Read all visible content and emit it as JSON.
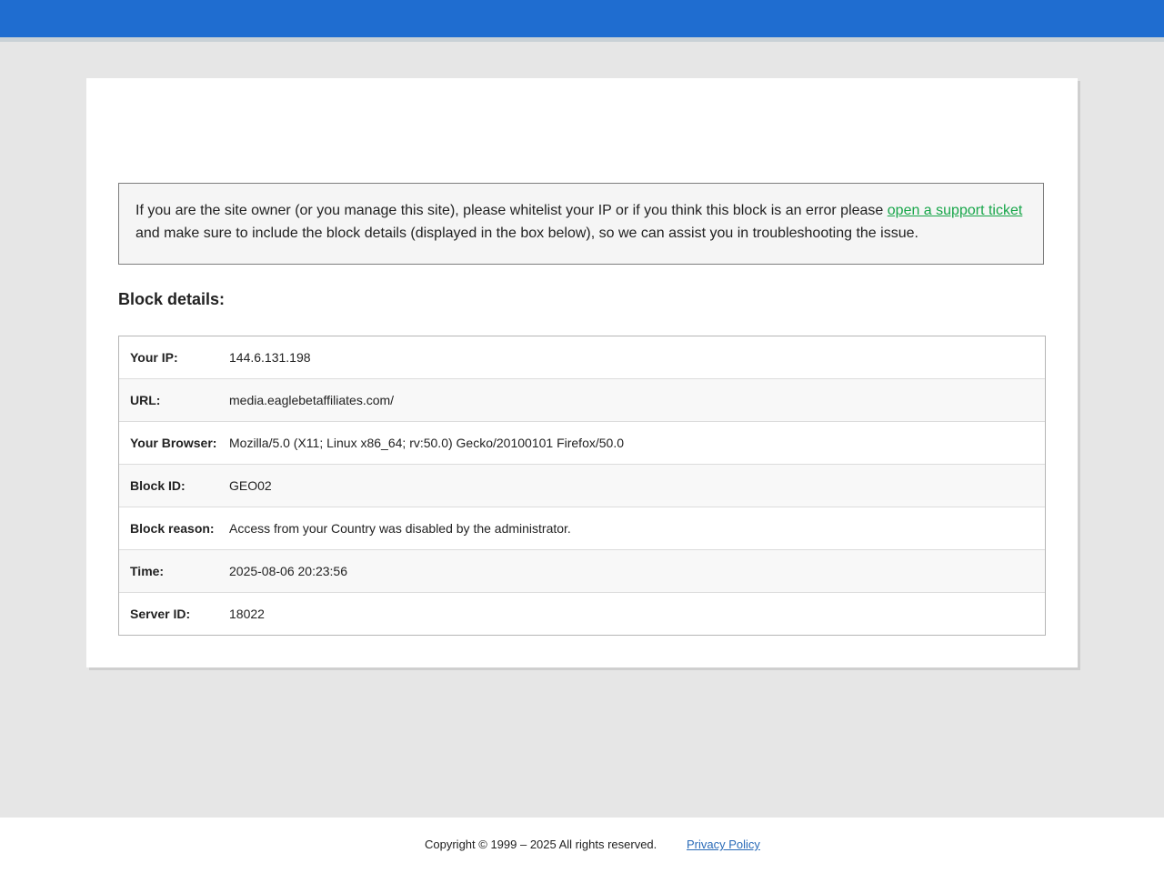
{
  "notice": {
    "text_before": "If you are the site owner (or you manage this site), please whitelist your IP or if you think this block is an error please ",
    "link_label": "open a support ticket",
    "text_after": " and make sure to include the block details (displayed in the box below), so we can assist you in troubleshooting the issue."
  },
  "block_details_title": "Block details:",
  "details": [
    {
      "label": "Your IP:",
      "value": "144.6.131.198"
    },
    {
      "label": "URL:",
      "value": "media.eaglebetaffiliates.com/"
    },
    {
      "label": "Your Browser:",
      "value": "Mozilla/5.0 (X11; Linux x86_64; rv:50.0) Gecko/20100101 Firefox/50.0"
    },
    {
      "label": "Block ID:",
      "value": "GEO02"
    },
    {
      "label": "Block reason:",
      "value": "Access from your Country was disabled by the administrator."
    },
    {
      "label": "Time:",
      "value": "2025-08-06 20:23:56"
    },
    {
      "label": "Server ID:",
      "value": "18022"
    }
  ],
  "footer": {
    "copyright": "Copyright © 1999 – 2025 All rights reserved.",
    "privacy_label": "Privacy Policy"
  },
  "colors": {
    "topbar": "#1f6dd0",
    "link": "#18a64a",
    "privacy_link": "#2a6bb8"
  }
}
